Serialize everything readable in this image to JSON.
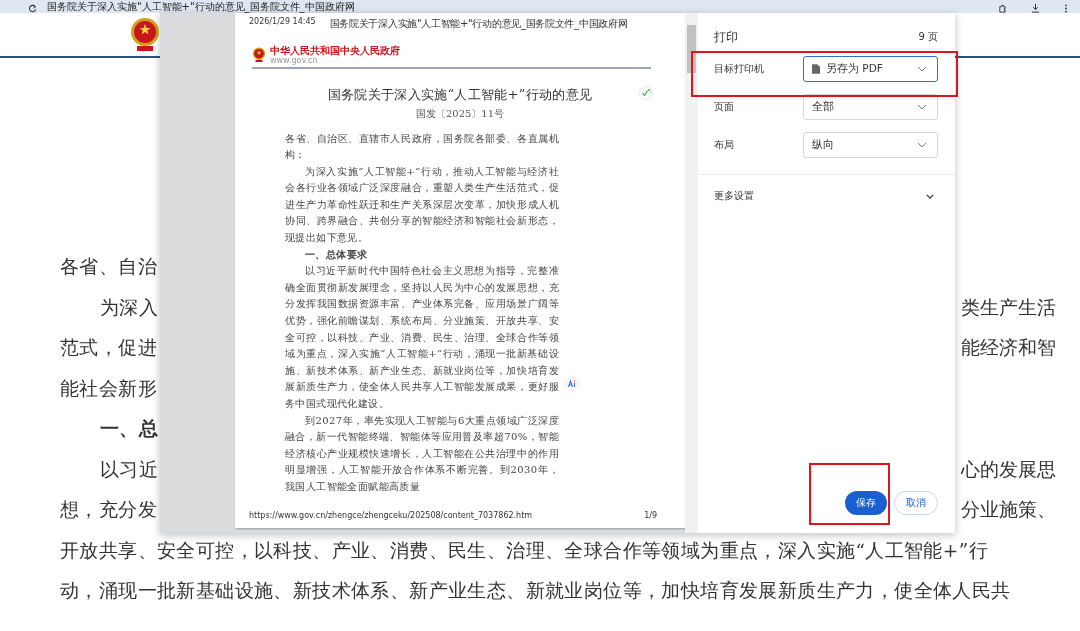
{
  "browser": {
    "tab_title": "国务院关于深入实施\"人工智能+\"行动的意见_国务院文件_中国政府网"
  },
  "background_page": {
    "lines": [
      {
        "kind": "plain",
        "left": "各省、自治"
      },
      {
        "kind": "indent",
        "left": "为深入",
        "right": "类生产生活"
      },
      {
        "kind": "plain",
        "left": "范式，促进",
        "right": "能经济和智"
      },
      {
        "kind": "plain",
        "left": "能社会新形"
      },
      {
        "kind": "heading",
        "left": "一、总"
      },
      {
        "kind": "indent",
        "left": "以习近",
        "right": "心的发展思"
      },
      {
        "kind": "plain",
        "left": "想，充分发",
        "right": "分业施策、"
      },
      {
        "kind": "plain",
        "left": "开放共享、安全可控，以科技、产业、消费、民生、治理、全球合作等领域为重点，深入实施“人工智能+”行"
      },
      {
        "kind": "plain",
        "left": "动，涌现一批新基础设施、新技术体系、新产业生态、新就业岗位等，加快培育发展新质生产力，使全体人民共"
      }
    ]
  },
  "print_preview": {
    "header_date": "2026/1/29 14:45",
    "header_title": "国务院关于深入实施\"人工智能+\"行动的意见_国务院文件_中国政府网",
    "site_name": "中华人民共和国中央人民政府",
    "site_url": "www.gov.cn",
    "doc_title": "国务院关于深入实施“人工智能+”行动的意见",
    "doc_number": "国发〔2025〕11号",
    "paragraphs": [
      {
        "kind": "salutation",
        "text": "各省、自治区、直辖市人民政府，国务院各部委、各直属机构："
      },
      {
        "kind": "body",
        "text": "为深入实施“人工智能+”行动，推动人工智能与经济社会各行业各领域广泛深度融合，重塑人类生产生活范式，促进生产力革命性跃迁和生产关系深层次变革，加快形成人机协同、跨界融合、共创分享的智能经济和智能社会新形态，现提出如下意见。"
      },
      {
        "kind": "heading",
        "text": "一、总体要求"
      },
      {
        "kind": "body",
        "text": "以习近平新时代中国特色社会主义思想为指导，完整准确全面贯彻新发展理念，坚持以人民为中心的发展思想，充分发挥我国数据资源丰富、产业体系完备、应用场景广阔等优势，强化前瞻谋划、系统布局、分业施策、开放共享、安全可控，以科技、产业、消费、民生、治理、全球合作等领域为重点，深入实施“人工智能+”行动，涌现一批新基础设施、新技术体系、新产业生态、新就业岗位等，加快培育发展新质生产力，使全体人民共享人工智能发展成果，更好服务中国式现代化建设。"
      },
      {
        "kind": "body",
        "text": "到2027年，率先实现人工智能与6大重点领域广泛深度融合，新一代智能终端、智能体等应用普及率超70%，智能经济核心产业规模快速增长，人工智能在公共治理中的作用明显增强，人工智能开放合作体系不断完善。到2030年，我国人工智能全面赋能高质量"
      }
    ],
    "footer_url": "https://www.gov.cn/zhengce/zhengceku/202508/content_7037862.htm",
    "page_number": "1/9"
  },
  "print_panel": {
    "title": "打印",
    "page_count": "9 页",
    "settings": [
      {
        "kind": "destination",
        "label": "目标打印机",
        "value": "另存为 PDF",
        "focused": true
      },
      {
        "kind": "select",
        "label": "页面",
        "value": "全部",
        "focused": false
      },
      {
        "kind": "select",
        "label": "布局",
        "value": "纵向",
        "focused": false
      }
    ],
    "more_settings": "更多设置",
    "buttons": [
      {
        "kind": "primary",
        "label": "保存"
      },
      {
        "kind": "secondary",
        "label": "取消"
      }
    ]
  }
}
